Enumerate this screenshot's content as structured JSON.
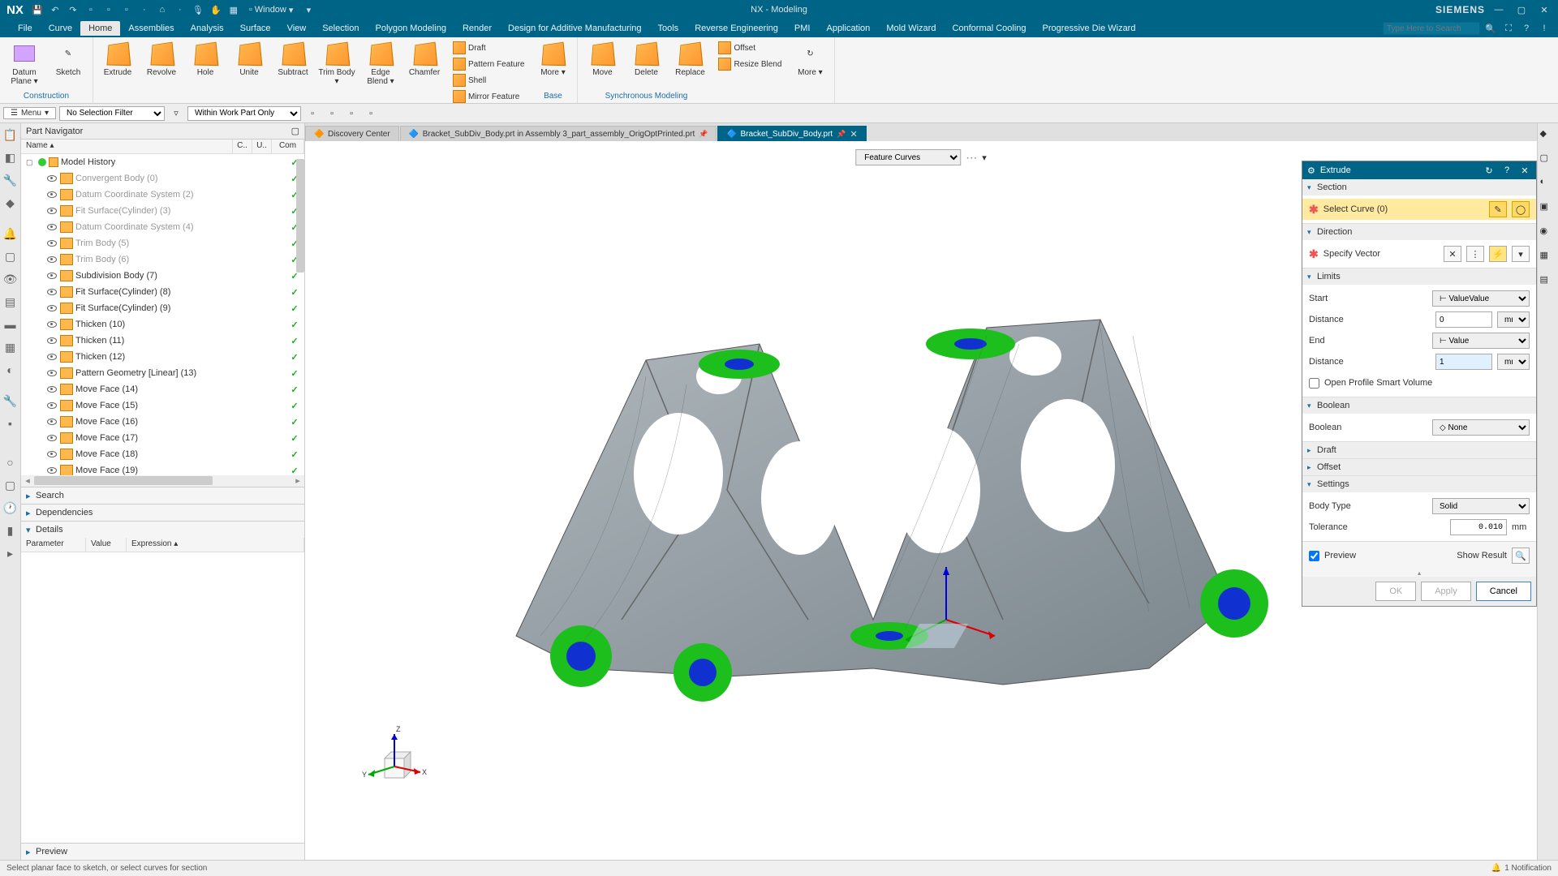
{
  "titlebar": {
    "app_logo": "NX",
    "window_menu": "Window",
    "app_title": "NX - Modeling",
    "brand": "SIEMENS"
  },
  "menubar": {
    "items": [
      "File",
      "Curve",
      "Home",
      "Assemblies",
      "Analysis",
      "Surface",
      "View",
      "Selection",
      "Polygon Modeling",
      "Render",
      "Design for Additive Manufacturing",
      "Tools",
      "Reverse Engineering",
      "PMI",
      "Application",
      "Mold Wizard",
      "Conformal Cooling",
      "Progressive Die Wizard"
    ],
    "active": "Home",
    "search_placeholder": "Type Here to Search"
  },
  "ribbon": {
    "groups": {
      "construction": {
        "label": "Construction",
        "big": [
          {
            "l": "Datum\nPlane ▾"
          },
          {
            "l": "Sketch"
          }
        ]
      },
      "feature": {
        "big": [
          {
            "l": "Extrude"
          },
          {
            "l": "Revolve"
          },
          {
            "l": "Hole"
          },
          {
            "l": "Unite"
          },
          {
            "l": "Subtract"
          },
          {
            "l": "Trim\nBody ▾"
          },
          {
            "l": "Edge\nBlend ▾"
          },
          {
            "l": "Chamfer"
          }
        ],
        "small": [
          {
            "l": "Draft"
          },
          {
            "l": "Pattern Feature"
          },
          {
            "l": "Shell"
          },
          {
            "l": "Mirror Feature"
          }
        ],
        "more": "More\n▾",
        "label": "Base"
      },
      "sync": {
        "label": "Synchronous Modeling",
        "big": [
          {
            "l": "Move"
          },
          {
            "l": "Delete"
          },
          {
            "l": "Replace"
          }
        ],
        "small": [
          {
            "l": "Offset"
          },
          {
            "l": "Resize Blend"
          }
        ],
        "more": "More\n▾"
      }
    }
  },
  "filterbar": {
    "menu_label": "Menu",
    "filter1": "No Selection Filter",
    "filter2": "Within Work Part Only"
  },
  "navigator": {
    "title": "Part Navigator",
    "cols": {
      "name": "Name",
      "c": "C..",
      "u": "U..",
      "com": "Com"
    },
    "root": "Model History",
    "items": [
      {
        "l": "Convergent Body (0)",
        "dim": true,
        "chk": true
      },
      {
        "l": "Datum Coordinate System (2)",
        "dim": true,
        "chk": true
      },
      {
        "l": "Fit Surface(Cylinder) (3)",
        "dim": true,
        "chk": true
      },
      {
        "l": "Datum Coordinate System (4)",
        "dim": true,
        "chk": true
      },
      {
        "l": "Trim Body (5)",
        "dim": true,
        "chk": true
      },
      {
        "l": "Trim Body (6)",
        "dim": true,
        "chk": true
      },
      {
        "l": "Subdivision Body (7)",
        "dim": false,
        "chk": true
      },
      {
        "l": "Fit Surface(Cylinder) (8)",
        "dim": false,
        "chk": true
      },
      {
        "l": "Fit Surface(Cylinder) (9)",
        "dim": false,
        "chk": true
      },
      {
        "l": "Thicken (10)",
        "dim": false,
        "chk": true
      },
      {
        "l": "Thicken (11)",
        "dim": false,
        "chk": true
      },
      {
        "l": "Thicken (12)",
        "dim": false,
        "chk": true
      },
      {
        "l": "Pattern Geometry [Linear] (13)",
        "dim": false,
        "chk": true
      },
      {
        "l": "Move Face (14)",
        "dim": false,
        "chk": true
      },
      {
        "l": "Move Face (15)",
        "dim": false,
        "chk": true
      },
      {
        "l": "Move Face (16)",
        "dim": false,
        "chk": true
      },
      {
        "l": "Move Face (17)",
        "dim": false,
        "chk": true
      },
      {
        "l": "Move Face (18)",
        "dim": false,
        "chk": true
      },
      {
        "l": "Move Face (19)",
        "dim": false,
        "chk": true
      }
    ],
    "sections": {
      "search": "Search",
      "deps": "Dependencies",
      "details": "Details",
      "preview": "Preview"
    },
    "details_cols": {
      "param": "Parameter",
      "value": "Value",
      "expr": "Expression"
    }
  },
  "doctabs": [
    {
      "l": "Discovery Center",
      "active": false
    },
    {
      "l": "Bracket_SubDiv_Body.prt in Assembly 3_part_assembly_OrigOptPrinted.prt",
      "active": false
    },
    {
      "l": "Bracket_SubDiv_Body.prt",
      "active": true
    }
  ],
  "canvas": {
    "selector": "Feature Curves",
    "triad": {
      "x": "X",
      "y": "Y",
      "z": "Z"
    }
  },
  "dialog": {
    "title": "Extrude",
    "section": {
      "head": "Section",
      "select": "Select Curve (0)"
    },
    "direction": {
      "head": "Direction",
      "specify": "Specify Vector"
    },
    "limits": {
      "head": "Limits",
      "start": "Start",
      "start_type": "Value",
      "start_dist": "Distance",
      "start_val": "0",
      "end": "End",
      "end_type": "Value",
      "end_dist": "Distance",
      "end_val": "1",
      "open": "Open Profile Smart Volume",
      "unit": "mm"
    },
    "boolean": {
      "head": "Boolean",
      "label": "Boolean",
      "val": "None"
    },
    "draft": "Draft",
    "offset": "Offset",
    "settings": {
      "head": "Settings",
      "body_type": "Body Type",
      "body_val": "Solid",
      "tol": "Tolerance",
      "tol_val": "0.010",
      "tol_unit": "mm"
    },
    "preview": "Preview",
    "show_result": "Show Result",
    "buttons": {
      "ok": "OK",
      "apply": "Apply",
      "cancel": "Cancel"
    }
  },
  "statusbar": {
    "hint": "Select planar face to sketch, or select curves for section",
    "notif": "1 Notification"
  }
}
